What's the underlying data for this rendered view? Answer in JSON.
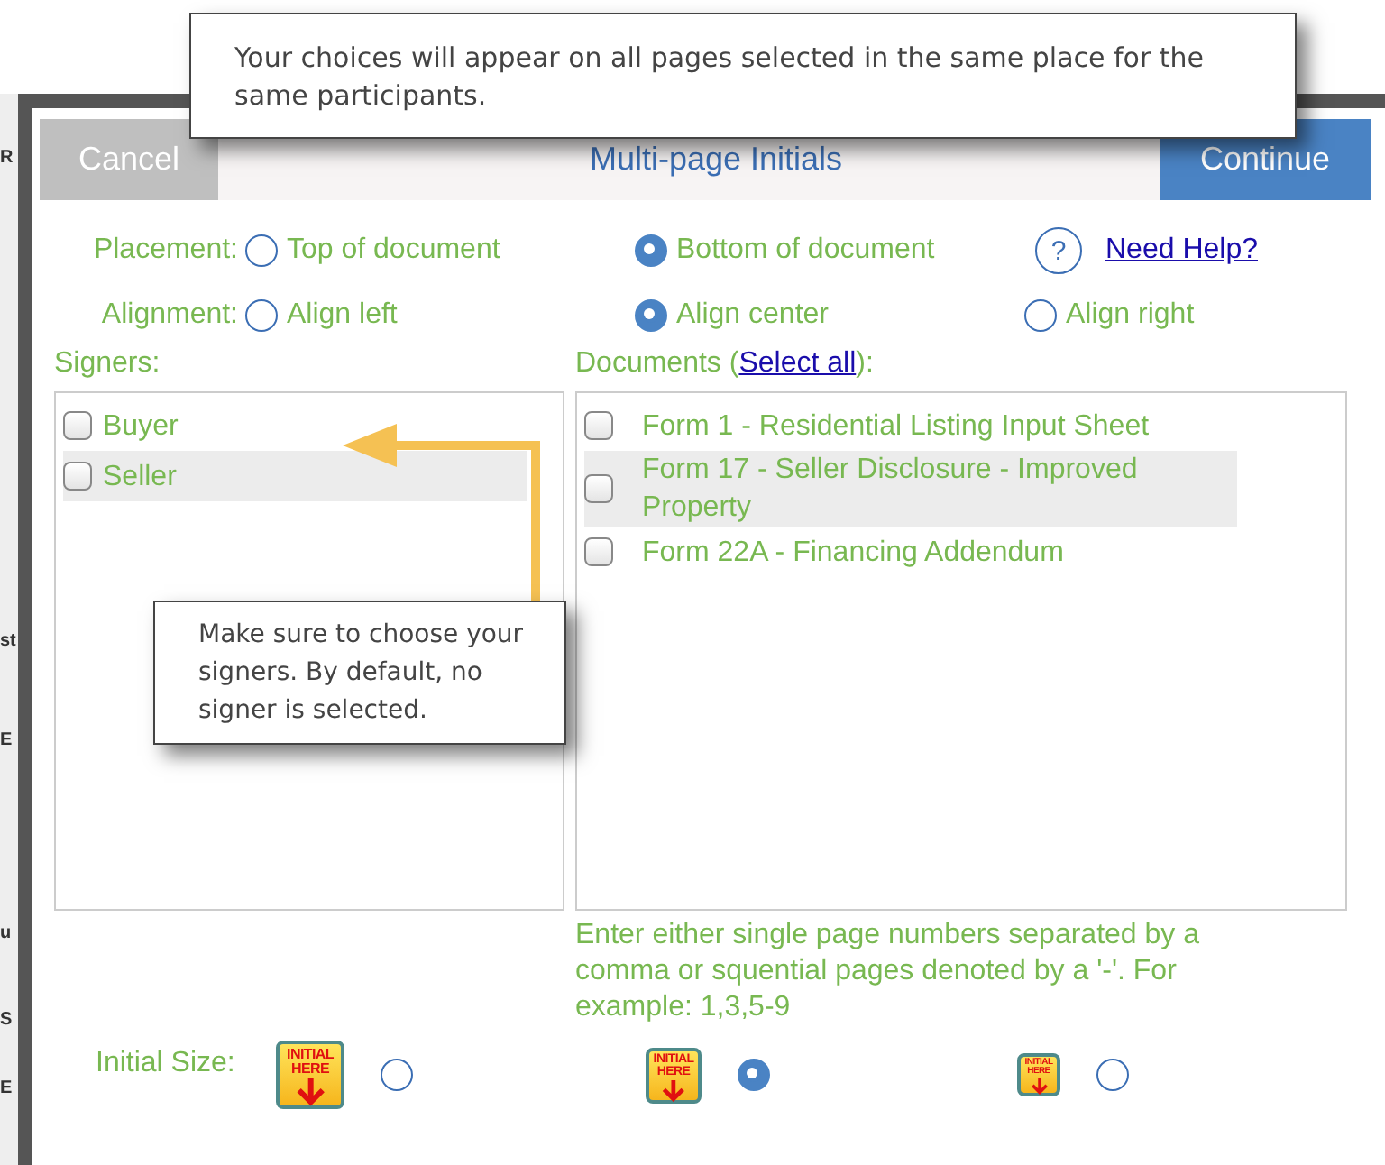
{
  "background_fragments": [
    "R",
    "st",
    "E",
    "u",
    "S",
    "E"
  ],
  "tooltip": "Your choices will appear on all pages selected in the same place for the same participants.",
  "dialog": {
    "title": "Multi-page Initials",
    "cancel": "Cancel",
    "continue": "Continue"
  },
  "placement": {
    "label": "Placement:",
    "options": [
      {
        "label": "Top of document",
        "selected": false
      },
      {
        "label": "Bottom of document",
        "selected": true
      }
    ]
  },
  "help": {
    "icon": "?",
    "link": "Need Help?"
  },
  "alignment": {
    "label": "Alignment:",
    "options": [
      {
        "label": "Align left",
        "selected": false
      },
      {
        "label": "Align center",
        "selected": true
      },
      {
        "label": "Align right",
        "selected": false
      }
    ]
  },
  "signers": {
    "label": "Signers:",
    "items": [
      {
        "name": "Buyer",
        "checked": false,
        "highlighted": false
      },
      {
        "name": "Seller",
        "checked": false,
        "highlighted": true
      }
    ]
  },
  "documents": {
    "label_before": "Documents (",
    "select_all": "Select all",
    "label_after": "):",
    "items": [
      {
        "name": "Form 1 - Residential Listing Input Sheet",
        "checked": false,
        "highlighted": false
      },
      {
        "name": "Form 17 - Seller Disclosure - Improved Property",
        "checked": false,
        "highlighted": true
      },
      {
        "name": "Form 22A - Financing Addendum",
        "checked": false,
        "highlighted": false
      }
    ]
  },
  "page_hint": "Enter either single page numbers separated by a comma or squential pages denoted by a '-'. For example: 1,3,5-9",
  "initial_size": {
    "label": "Initial Size:",
    "options": [
      {
        "kind": "large",
        "stamp": [
          "INITIAL",
          "HERE"
        ],
        "selected": false
      },
      {
        "kind": "medium",
        "stamp": [
          "INITIAL",
          "HERE"
        ],
        "selected": true
      },
      {
        "kind": "small",
        "stamp": [
          "INITIAL",
          "HERE"
        ],
        "selected": false
      }
    ]
  },
  "callout": "Make sure to choose your signers.  By default, no signer is selected."
}
